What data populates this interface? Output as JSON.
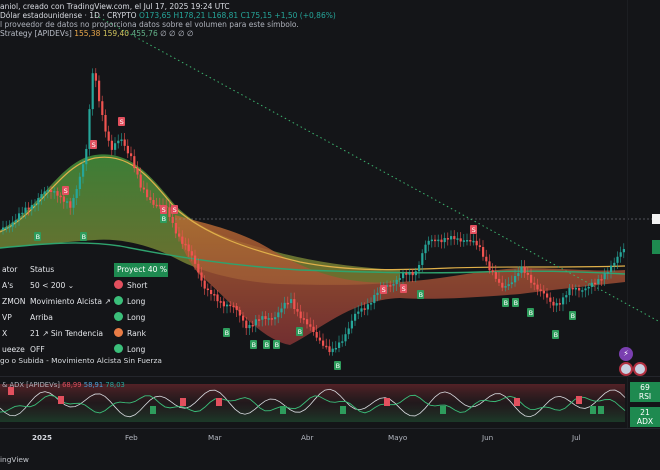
{
  "header": {
    "creator_line": "aniol, creado con TradingView.com, el Jul 17, 2025 19:24 UTC",
    "symbol_line_prefix": "Dólar estadounidense · 1D · CRYPTO",
    "ohlc": "O173,65 H178,21 L168,81 C175,15 +1,50 (+0,86%)",
    "volume_note": "l proveedor de datos no proporciona datos sobre el volumen para este símbolo.",
    "strategy_name": "Strategy [APIDEVs]",
    "strategy_values": [
      "155,38",
      "159,40",
      "455,76",
      "∅ ∅ ∅ ∅"
    ]
  },
  "status_table": {
    "header": {
      "c1": "ator",
      "c2": "Status",
      "c3": "Proyect 40 %"
    },
    "rows": [
      {
        "c1": "A's",
        "c2": "50 < 200",
        "c2_icon": "chevron-down",
        "c3": "Short",
        "color": "#e2505e"
      },
      {
        "c1": "ZMON",
        "c2": "Movimiento Alcista ↗",
        "c3": "Long",
        "color": "#3bbf7a"
      },
      {
        "c1": "VP",
        "c2": "Arriba",
        "c3": "Long",
        "color": "#3bbf7a"
      },
      {
        "c1": "X",
        "c2": "21 ↗ Sin Tendencia",
        "c3": "Rank",
        "color": "#e97c45"
      },
      {
        "c1": "ueeze",
        "c2": "OFF",
        "c3": "Long",
        "color": "#3bbf7a"
      }
    ],
    "trend_text": "go o Subida - Movimiento Alcista Sin Fuerza"
  },
  "lower_indicator": {
    "label": "& ADX [APIDEVs]",
    "values": [
      "68,99",
      "58,91",
      "78,03"
    ]
  },
  "right_badges": {
    "rsi_value": "69",
    "rsi_label": "RSI",
    "adx_value": "21",
    "adx_label": "ADX"
  },
  "time_axis": [
    {
      "label": "2025",
      "bold": true
    },
    {
      "label": "Feb",
      "bold": false
    },
    {
      "label": "Mar",
      "bold": false
    },
    {
      "label": "Abr",
      "bold": false
    },
    {
      "label": "Mayo",
      "bold": false
    },
    {
      "label": "Jun",
      "bold": false
    },
    {
      "label": "Jul",
      "bold": false
    }
  ],
  "brand": "ingView",
  "colors": {
    "background": "#141518",
    "bull": "#26a69a",
    "bear": "#ef5350",
    "badge_green": "#1e8a50"
  }
}
